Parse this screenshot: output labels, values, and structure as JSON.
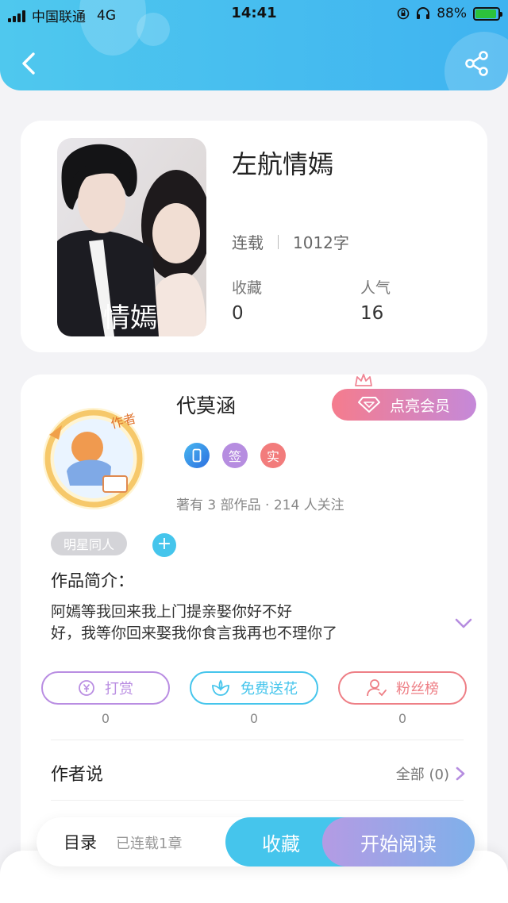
{
  "status_bar": {
    "carrier": "中国联通",
    "network": "4G",
    "time": "14:41",
    "battery": "88%",
    "battery_level": 0.88
  },
  "nav": {
    "back_icon": "chevron-left-icon",
    "share_icon": "share-icon"
  },
  "book": {
    "title": "左航情嫣",
    "cover_text": "情嫣",
    "status": "连载",
    "word_count": "1012字",
    "favorites_label": "收藏",
    "favorites_value": "0",
    "popularity_label": "人气",
    "popularity_value": "16"
  },
  "author": {
    "name": "代莫涵",
    "avatar_badge": "作者",
    "vip_button": "点亮会员",
    "badges": [
      {
        "icon": "phone-icon",
        "label": "",
        "color": "#3a8fe6"
      },
      {
        "label": "签",
        "color": "#b68de0"
      },
      {
        "label": "实",
        "color": "#f27c7c"
      }
    ],
    "meta": "著有 3 部作品 · 214 人关注",
    "tag": "明星同人",
    "tag_add": "+"
  },
  "intro": {
    "title": "作品简介：",
    "line1": "阿嫣等我回来我上门提亲娶你好不好",
    "line2": "好，我等你回来娶我你食言我再也不理你了"
  },
  "actions": [
    {
      "label": "打赏",
      "count": "0",
      "icon": "yuan-coin-icon",
      "color": "#b98de2"
    },
    {
      "label": "免费送花",
      "count": "0",
      "icon": "flower-icon",
      "color": "#45c5ec"
    },
    {
      "label": "粉丝榜",
      "count": "0",
      "icon": "user-rank-icon",
      "color": "#ee7f86"
    }
  ],
  "author_says": {
    "title": "作者说",
    "all_label": "全部 (0)"
  },
  "bottom_bar": {
    "toc": "目录",
    "chapters": "已连载1章",
    "favorite": "收藏",
    "read": "开始阅读"
  },
  "colors": {
    "accent_blue": "#45c5ec",
    "accent_purple": "#b98de2",
    "accent_pink": "#ee7f86"
  }
}
